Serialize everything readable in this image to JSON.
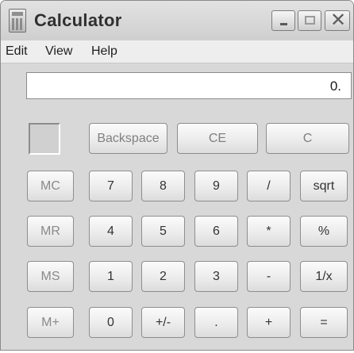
{
  "window": {
    "title": "Calculator",
    "controls": {
      "minimize": "minimize",
      "maximize": "maximize",
      "close": "✕"
    }
  },
  "menu": [
    {
      "label": "Edit"
    },
    {
      "label": "View"
    },
    {
      "label": "Help"
    }
  ],
  "display": {
    "value": "0."
  },
  "top_row": {
    "backspace": "Backspace",
    "ce": "CE",
    "c": "C"
  },
  "memory": {
    "mc": "MC",
    "mr": "MR",
    "ms": "MS",
    "mplus": "M+"
  },
  "keys": {
    "k7": "7",
    "k8": "8",
    "k9": "9",
    "div": "/",
    "sqrt": "sqrt",
    "k4": "4",
    "k5": "5",
    "k6": "6",
    "mul": "*",
    "pct": "%",
    "k1": "1",
    "k2": "2",
    "k3": "3",
    "sub": "-",
    "inv": "1/x",
    "k0": "0",
    "sign": "+/-",
    "dot": ".",
    "add": "+",
    "eq": "="
  },
  "colors": {
    "window_bg": "#d8d8d8",
    "button_text": "#333333",
    "memory_text": "#8a8a8a"
  }
}
